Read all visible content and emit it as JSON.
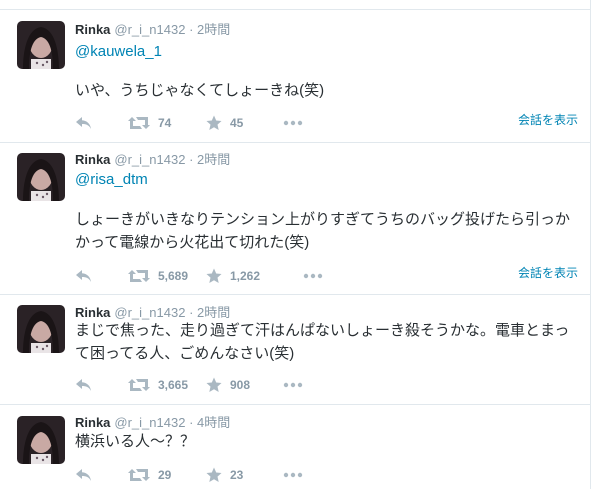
{
  "tweets": [
    {
      "name": "Rinka",
      "handle": "@r_i_n1432",
      "sep": "·",
      "time": "2時間",
      "mention": "@kauwela_1",
      "text": "いや、うちじゃなくてしょーきね(笑)",
      "retweets": "74",
      "favorites": "45",
      "convo": "会話を表示",
      "icons": [
        "reply-icon",
        "retweet-icon",
        "star-icon",
        "more-icon"
      ]
    },
    {
      "name": "Rinka",
      "handle": "@r_i_n1432",
      "sep": "·",
      "time": "2時間",
      "mention": "@risa_dtm",
      "text": "しょーきがいきなりテンション上がりすぎてうちのバッグ投げたら引っかかって電線から火花出て切れた(笑)",
      "retweets": "5,689",
      "favorites": "1,262",
      "convo": "会話を表示"
    },
    {
      "name": "Rinka",
      "handle": "@r_i_n1432",
      "sep": "·",
      "time": "2時間",
      "text": "まじで焦った、走り過ぎて汗はんぱないしょーき殺そうかな。電車とまって困ってる人、ごめんなさい(笑)",
      "retweets": "3,665",
      "favorites": "908"
    },
    {
      "name": "Rinka",
      "handle": "@r_i_n1432",
      "sep": "·",
      "time": "4時間",
      "text": "横浜いる人〜？？",
      "retweets": "29",
      "favorites": "23"
    }
  ],
  "colors": {
    "link": "#0084b4",
    "muted": "#8899a6",
    "icon": "#aab8c2",
    "border": "#e1e8ed"
  }
}
